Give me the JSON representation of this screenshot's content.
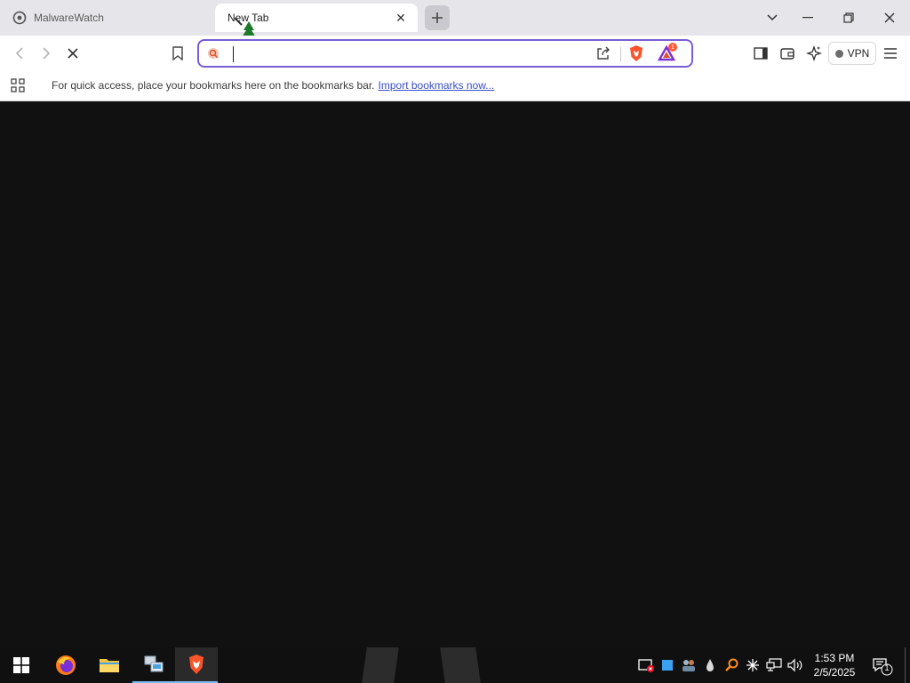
{
  "window": {
    "tabs": [
      {
        "title": "MalwareWatch",
        "active": false
      },
      {
        "title": "New Tab",
        "active": true
      }
    ]
  },
  "toolbar": {
    "omnibox_value": "",
    "vpn_label": "VPN",
    "rewards_badge": "1"
  },
  "bookmarks_bar": {
    "message": "For quick access, place your bookmarks here on the bookmarks bar.",
    "import_link": "Import bookmarks now..."
  },
  "taskbar": {
    "apps": [
      "start-icon",
      "firefox-icon",
      "file-explorer-icon",
      "network-icon",
      "brave-icon"
    ],
    "time": "1:53 PM",
    "date": "2/5/2025",
    "notification_count": "1"
  },
  "colors": {
    "accent": "#7a5cd6",
    "brave_orange": "#fb542b",
    "content_bg": "#111111",
    "link": "#3a4fc9"
  }
}
